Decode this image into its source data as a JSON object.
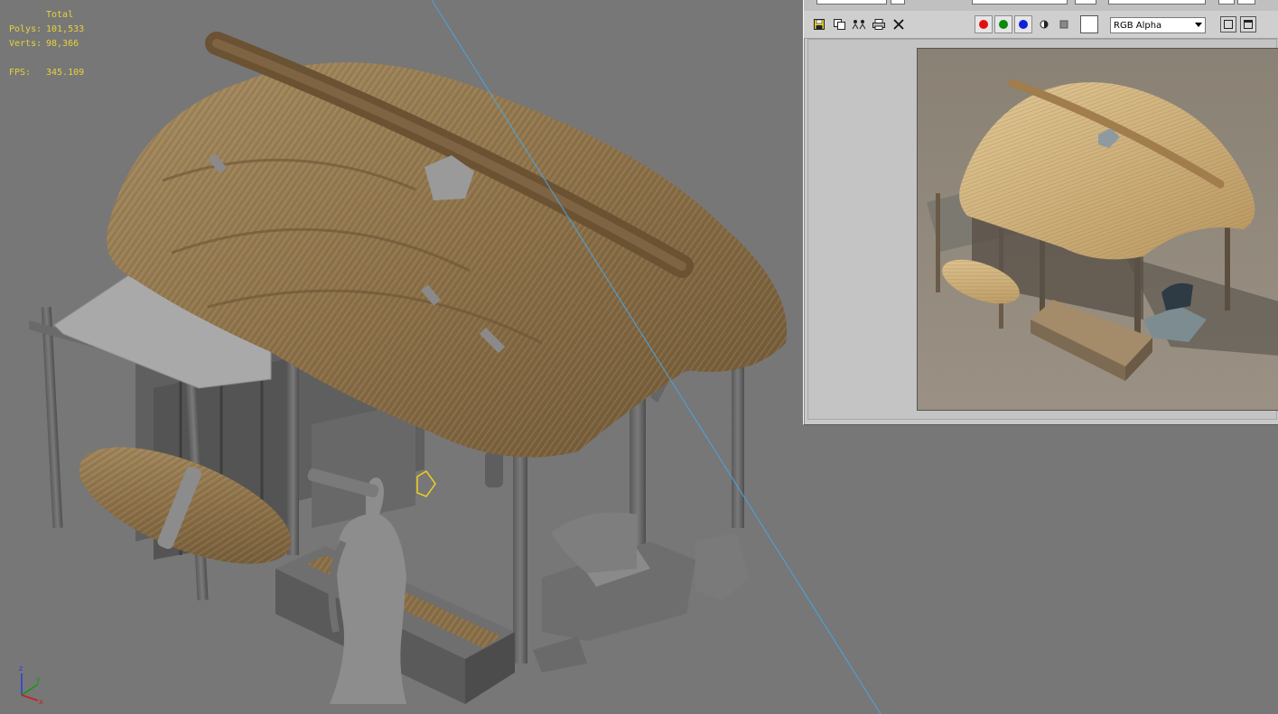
{
  "viewport": {
    "stats": {
      "header": "Total",
      "polys_label": "Polys:",
      "polys_value": "101,533",
      "verts_label": "Verts:",
      "verts_value": "98,366",
      "fps_label": "FPS:",
      "fps_value": "345.109"
    },
    "axis_gizmo": {
      "x": "x",
      "y": "y",
      "z": "z"
    },
    "colors": {
      "background": "#777777",
      "stats_text": "#e8d23a",
      "guide_line": "#4aa3e0"
    }
  },
  "frame_window": {
    "toolbar": {
      "icons": [
        "save-icon",
        "clone-icon",
        "channels-icon",
        "print-icon",
        "clear-icon"
      ],
      "channel_toggles": [
        {
          "name": "red-channel",
          "color": "#e01010"
        },
        {
          "name": "green-channel",
          "color": "#0a8a0a"
        },
        {
          "name": "blue-channel",
          "color": "#1020d8"
        }
      ],
      "swatch_color": "#ffffff",
      "channel_select_value": "RGB Alpha"
    }
  }
}
